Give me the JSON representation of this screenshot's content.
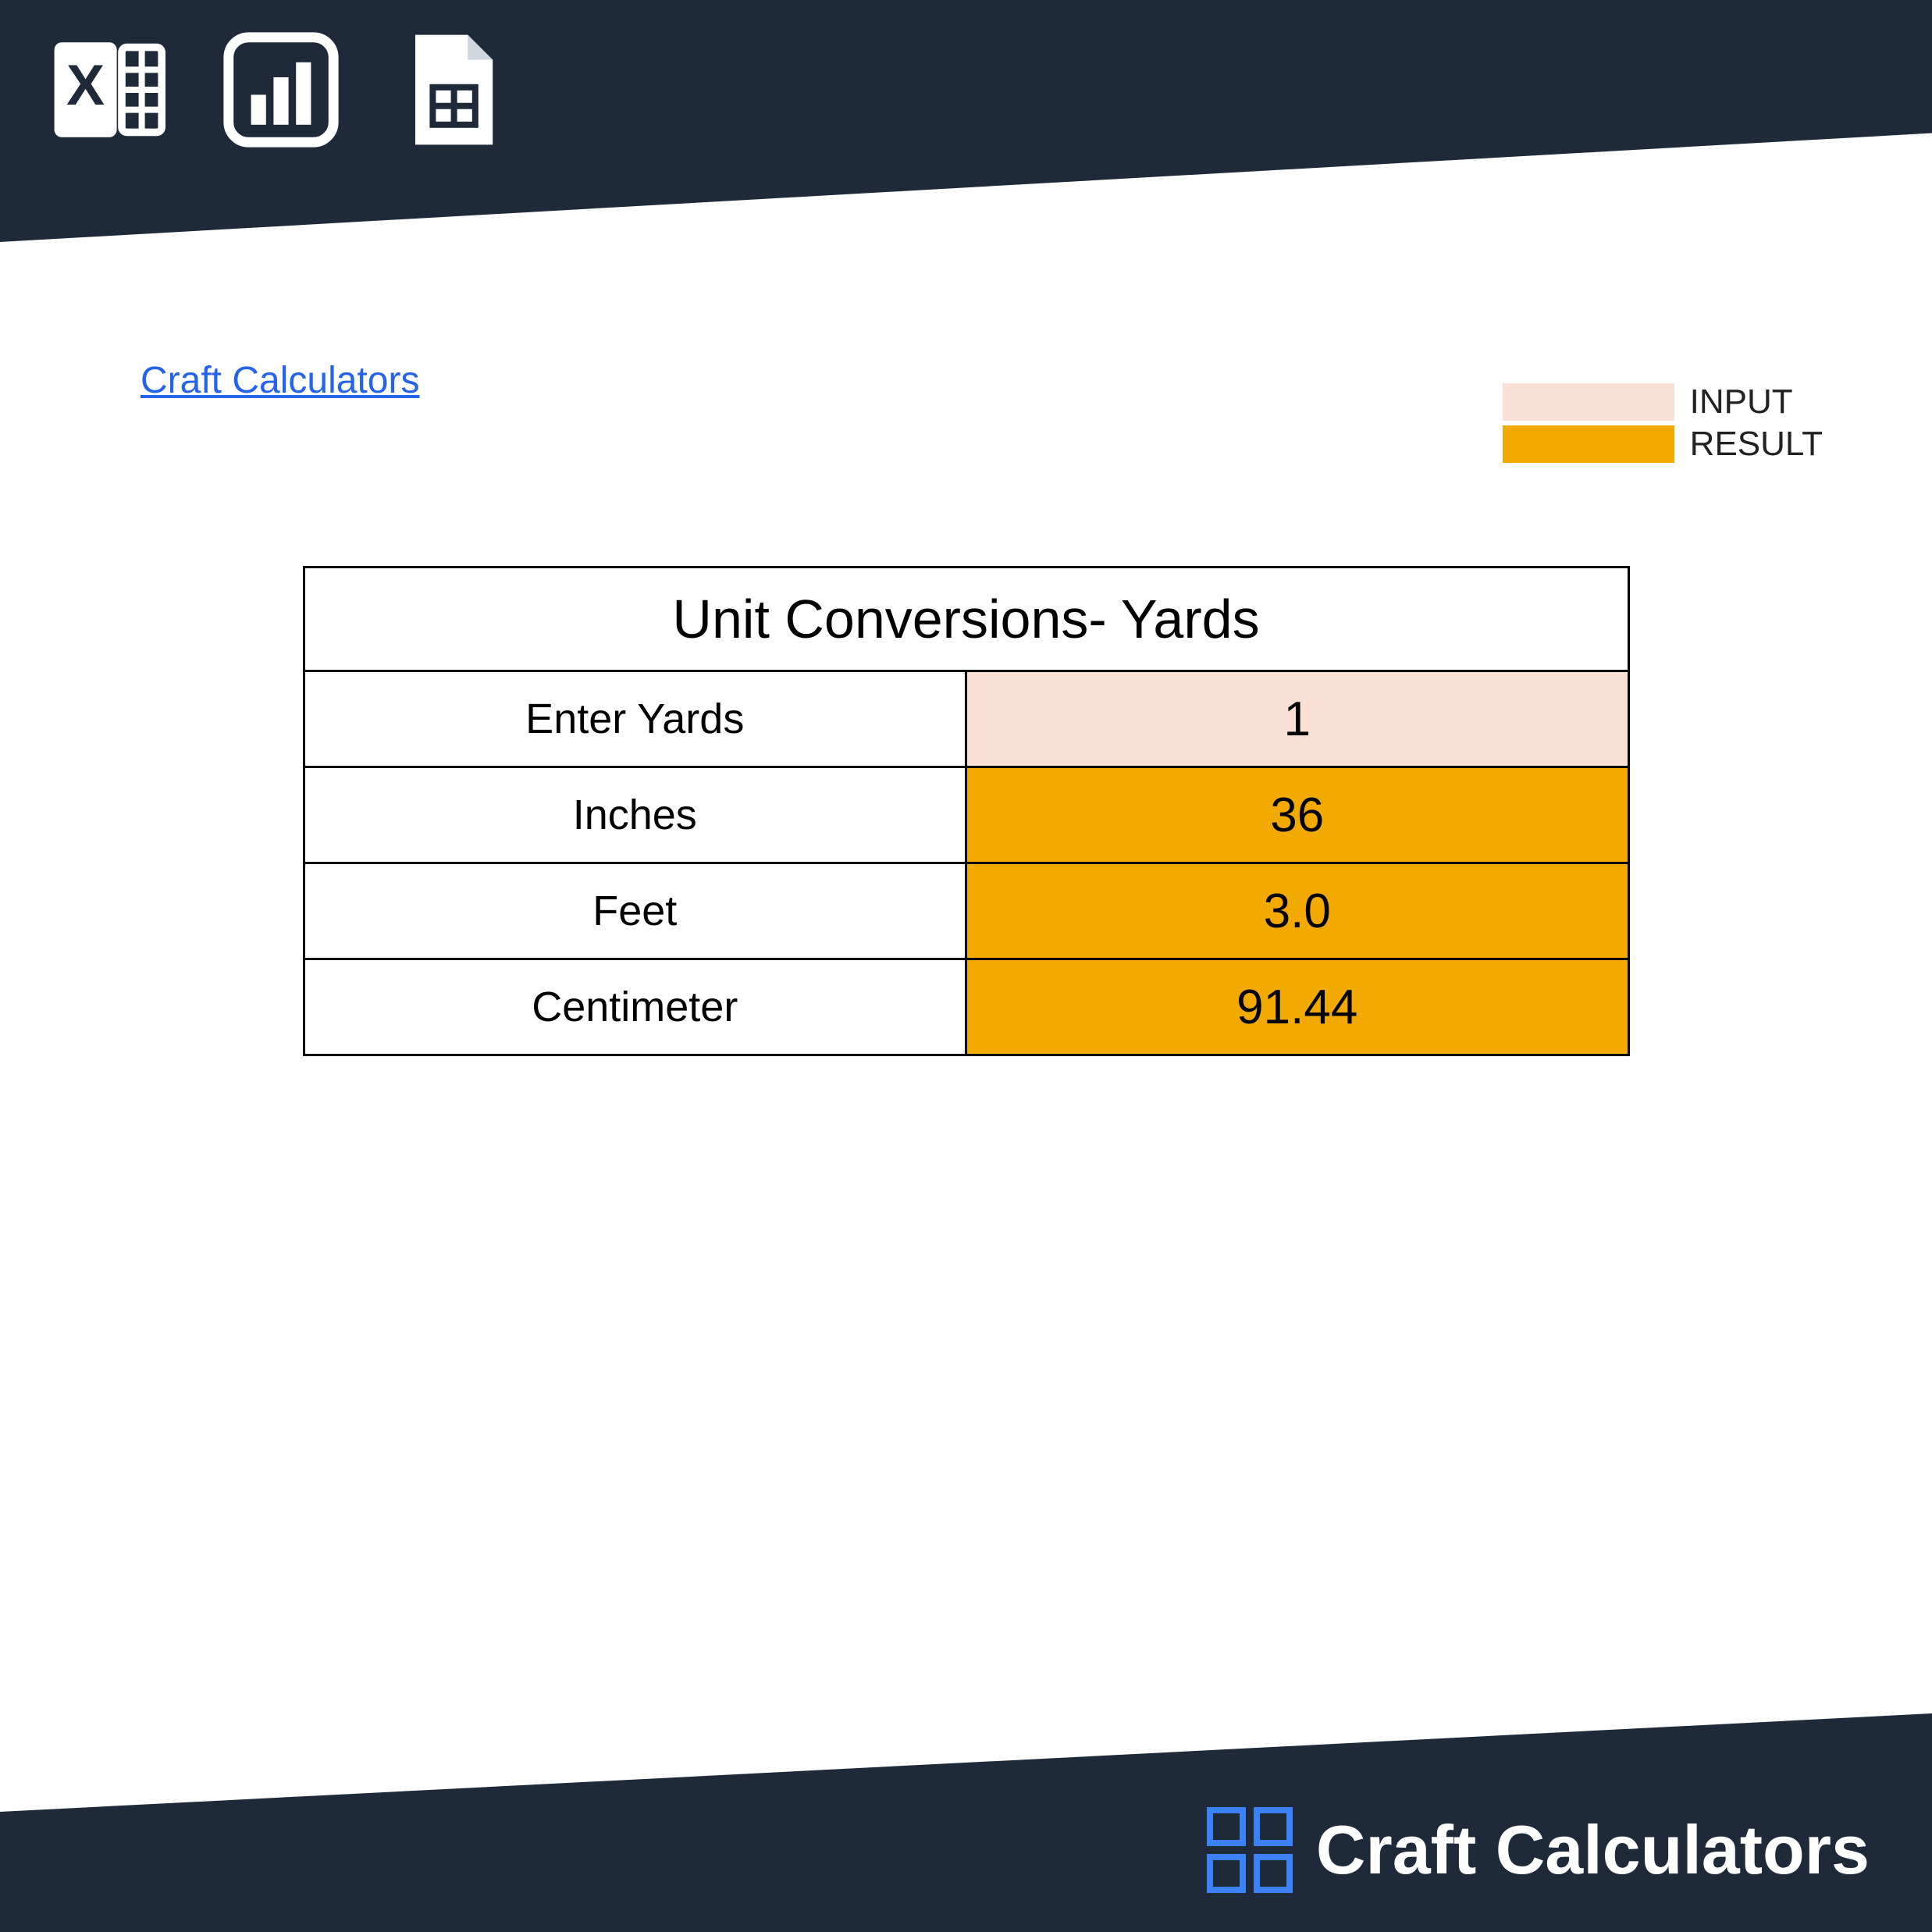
{
  "link_text": "Craft Calculators",
  "legend": {
    "input_label": "INPUT",
    "result_label": "RESULT",
    "input_color": "#fae0d4",
    "result_color": "#f2a900"
  },
  "table": {
    "title": "Unit Conversions- Yards",
    "rows": [
      {
        "label": "Enter Yards",
        "value": "1",
        "kind": "input"
      },
      {
        "label": "Inches",
        "value": "36",
        "kind": "result"
      },
      {
        "label": "Feet",
        "value": "3.0",
        "kind": "result"
      },
      {
        "label": "Centimeter",
        "value": "91.44",
        "kind": "result"
      }
    ]
  },
  "footer_brand": "Craft Calculators"
}
